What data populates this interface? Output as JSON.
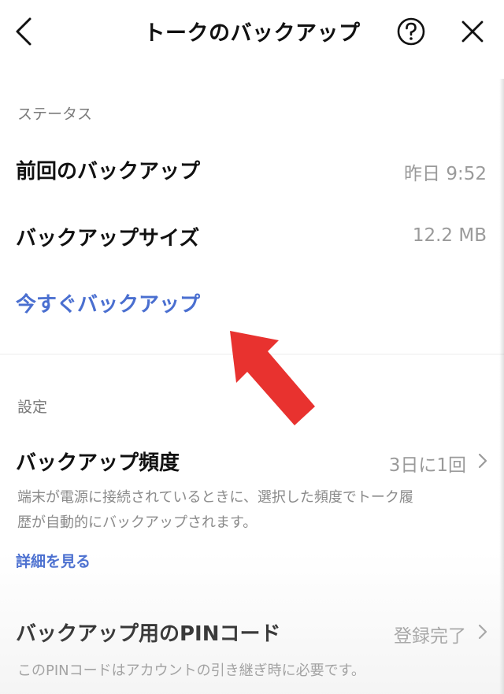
{
  "header": {
    "title": "トークのバックアップ"
  },
  "status": {
    "section_label": "ステータス",
    "last_backup_label": "前回のバックアップ",
    "last_backup_value": "昨日 9:52",
    "backup_size_label": "バックアップサイズ",
    "backup_size_value": "12.2 MB",
    "backup_now_label": "今すぐバックアップ"
  },
  "settings": {
    "section_label": "設定",
    "frequency_label": "バックアップ頻度",
    "frequency_value": "3日に1回",
    "frequency_desc_line1": "端末が電源に接続されているときに、選択した頻度でトーク履",
    "frequency_desc_line2": "歴が自動的にバックアップされます。",
    "details_link": "詳細を見る",
    "pin_label": "バックアップ用のPINコード",
    "pin_value": "登録完了",
    "pin_desc": "このPINコードはアカウントの引き継ぎ時に必要です。"
  },
  "colors": {
    "link": "#4a6fd0",
    "annotation_arrow": "#e8322f"
  },
  "icons": {
    "back": "chevron-left-icon",
    "help": "question-circle-icon",
    "close": "close-icon",
    "row_chevron": "chevron-right-icon",
    "annotation": "red-arrow-icon"
  }
}
